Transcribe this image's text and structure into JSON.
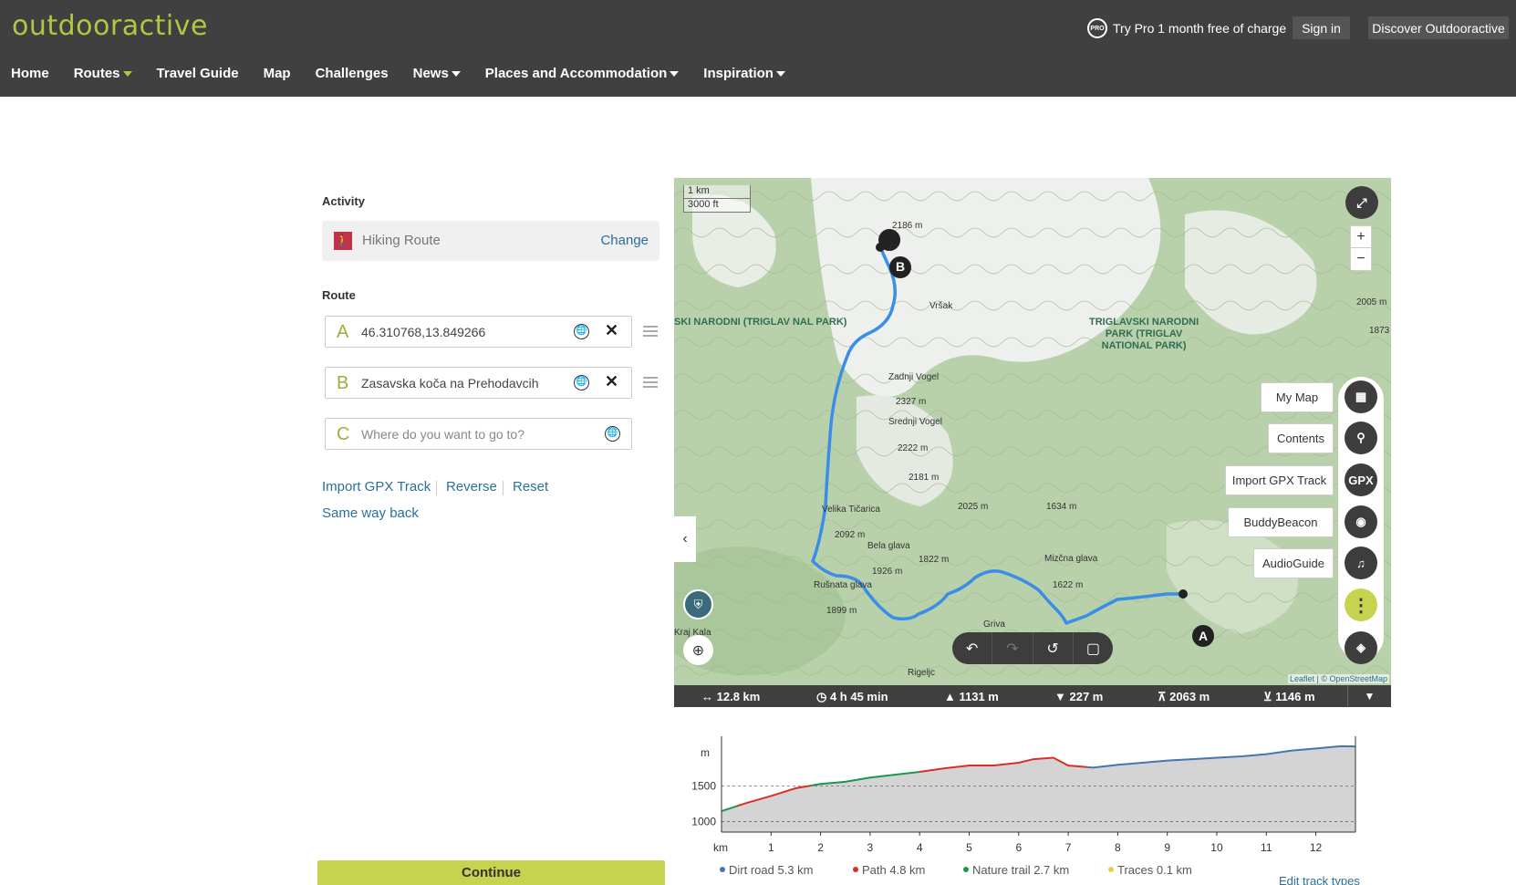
{
  "header": {
    "logo": "outdooractive",
    "promo": "Try Pro 1 month free of charge",
    "promo_badge": "PRO",
    "signin": "Sign in",
    "discover": "Discover Outdooractive"
  },
  "nav": [
    {
      "label": "Home",
      "caret": false
    },
    {
      "label": "Routes",
      "caret": true
    },
    {
      "label": "Travel Guide",
      "caret": false
    },
    {
      "label": "Map",
      "caret": false
    },
    {
      "label": "Challenges",
      "caret": false
    },
    {
      "label": "News",
      "caret": true
    },
    {
      "label": "Places and Accommodation",
      "caret": true
    },
    {
      "label": "Inspiration",
      "caret": true
    }
  ],
  "form": {
    "activity_label": "Activity",
    "activity_value": "Hiking Route",
    "change": "Change",
    "route_label": "Route",
    "waypoints": [
      {
        "letter": "A",
        "value": "46.310768,13.849266"
      },
      {
        "letter": "B",
        "value": "Zasavska koča na Prehodavcih"
      },
      {
        "letter": "C",
        "placeholder": "Where do you want to go to?"
      }
    ],
    "import_gpx": "Import GPX Track",
    "reverse": "Reverse",
    "reset": "Reset",
    "same_way_back": "Same way back",
    "continue": "Continue"
  },
  "map": {
    "scale_km": "1 km",
    "scale_ft": "3000 ft",
    "zoom_in": "+",
    "zoom_out": "−",
    "tags": {
      "my_map": "My Map",
      "contents": "Contents",
      "import_gpx": "Import GPX Track",
      "buddybeacon": "BuddyBeacon",
      "audioguide": "AudioGuide"
    },
    "gpx_button": "GPX",
    "attribution": "Leaflet | © OpenStreetMap",
    "marker_a": "A",
    "marker_b": "B",
    "labels": {
      "peak_2186": "2186 m",
      "vrsak": "Vršak",
      "zadnji_vogel": "Zadnji Vogel",
      "zv_alt": "2327 m",
      "srednji_vogel": "Srednji Vogel",
      "sv_alt": "2222 m",
      "alt_2181": "2181 m",
      "alt_2025": "2025 m",
      "alt_1634": "1634 m",
      "velika_ticarica": "Velika Tičarica",
      "vt_alt": "2092 m",
      "bela_glava": "Bela glava",
      "bg_alt": "1926 m",
      "alt_1822": "1822 m",
      "micna_glava": "Mizčna glava",
      "mg_alt": "1622 m",
      "rusnata_glava": "Rušnata glava",
      "rg_alt": "1899 m",
      "griva": "Griva",
      "rigeljc": "Rigeljc",
      "kraj_kala": "Kraj Kala",
      "alt_2005": "2005 m",
      "alt_1873": "1873",
      "park_left": "SKI NARODNI\n(TRIGLAV\nNAL PARK)",
      "park_right": "TRIGLAVSKI NARODNI\nPARK (TRIGLAV\nNATIONAL PARK)"
    }
  },
  "stats": {
    "distance": "12.8 km",
    "duration": "4 h 45 min",
    "ascent": "1131 m",
    "descent": "227 m",
    "max_alt": "2063 m",
    "min_alt": "1146 m"
  },
  "chart_data": {
    "type": "area",
    "xlabel": "km",
    "ylabel": "m",
    "x_ticks": [
      "1",
      "2",
      "3",
      "4",
      "5",
      "6",
      "7",
      "8",
      "9",
      "10",
      "11",
      "12"
    ],
    "y_ticks": [
      "1000",
      "1500"
    ],
    "xlim": [
      0,
      12.8
    ],
    "ylim": [
      850,
      2100
    ],
    "x": [
      0,
      0.5,
      1,
      1.5,
      2,
      2.5,
      3,
      3.5,
      4,
      4.5,
      5,
      5.5,
      6,
      6.3,
      6.7,
      7,
      7.5,
      8,
      8.5,
      9,
      9.5,
      10,
      10.5,
      11,
      11.5,
      12,
      12.5,
      12.8
    ],
    "y": [
      1146,
      1260,
      1360,
      1470,
      1530,
      1560,
      1620,
      1660,
      1700,
      1750,
      1790,
      1790,
      1830,
      1880,
      1900,
      1790,
      1760,
      1800,
      1830,
      1860,
      1880,
      1900,
      1920,
      1950,
      2000,
      2030,
      2063,
      2060
    ],
    "segments": [
      {
        "type": "Nature trail",
        "color": "#1a9850",
        "from": 0,
        "to": 0.3
      },
      {
        "type": "Path",
        "color": "#d73027",
        "from": 0.3,
        "to": 1.8
      },
      {
        "type": "Nature trail",
        "color": "#1a9850",
        "from": 1.8,
        "to": 4.0
      },
      {
        "type": "Path",
        "color": "#d73027",
        "from": 4.0,
        "to": 7.4
      },
      {
        "type": "Dirt road",
        "color": "#4575b4",
        "from": 7.4,
        "to": 12.8
      }
    ],
    "legend": [
      {
        "label": "Dirt road 5.3 km",
        "color": "#4575b4"
      },
      {
        "label": "Path 4.8 km",
        "color": "#d73027"
      },
      {
        "label": "Nature trail 2.7 km",
        "color": "#1a9850"
      },
      {
        "label": "Traces 0.1 km",
        "color": "#e6d240"
      }
    ],
    "edit_link": "Edit track types"
  }
}
